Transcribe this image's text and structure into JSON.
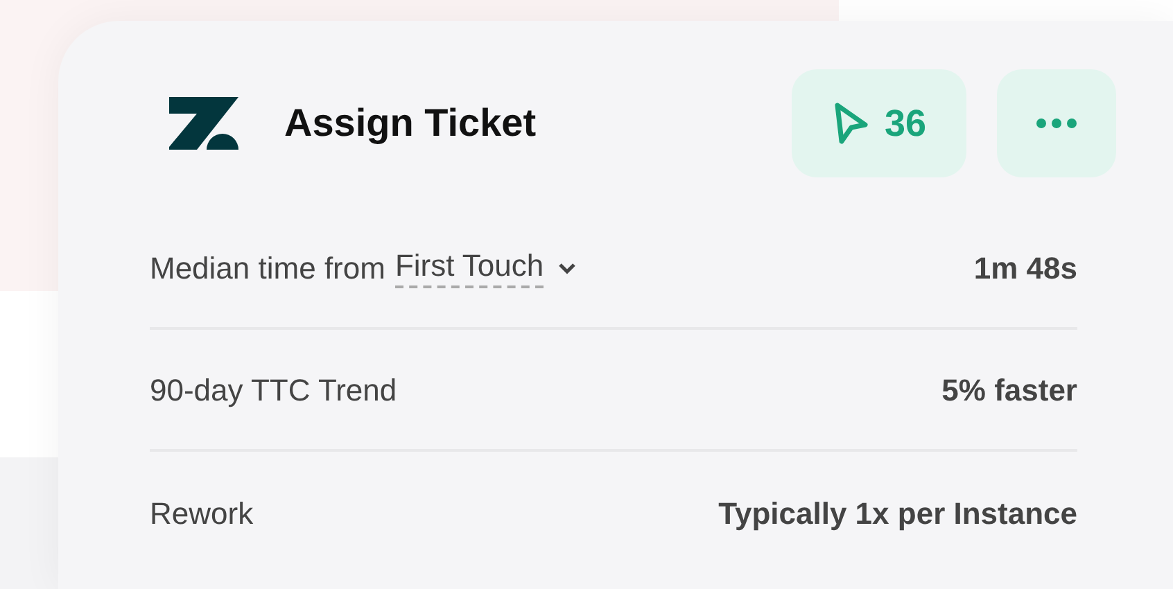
{
  "header": {
    "title": "Assign Ticket",
    "count": "36"
  },
  "metrics": [
    {
      "kind": "dropdown",
      "label": "Median time from",
      "option": "First Touch",
      "value": "1m 48s"
    },
    {
      "kind": "text",
      "label": "90-day TTC Trend",
      "value": "5% faster"
    },
    {
      "kind": "text",
      "label": "Rework",
      "value": "Typically 1x per Instance"
    }
  ]
}
